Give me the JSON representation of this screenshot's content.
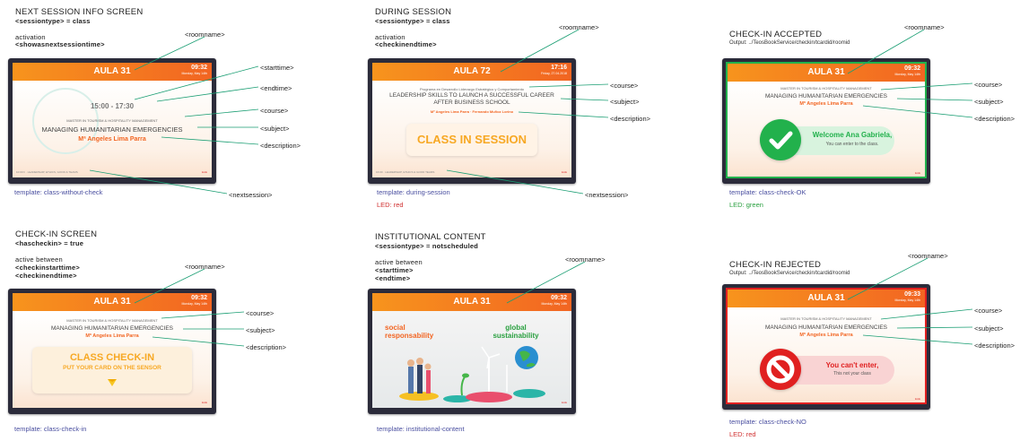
{
  "annotations": {
    "roomname": "<roomname>",
    "starttime": "<starttime>",
    "endtime": "<endtime>",
    "course": "<course>",
    "subject": "<subject>",
    "description": "<description>",
    "nextsession": "<nextsession>"
  },
  "screen_common": {
    "room_31": "AULA 31",
    "room_72": "AULA 72",
    "clock_0932": "09:32",
    "clock_0933": "09:33",
    "clock_1716": "17:16",
    "date_monday": "Monday, May 14th",
    "date_friday": "Friday, 27.04.2018",
    "course_mt": "MASTER IN TOURISM & HOSPITALITY MANAGEMENT",
    "subject_mhe": "MANAGING HUMANITARIAN EMERGENCIES",
    "desc_mlp": "Mª Angeles Lima Parra",
    "footer_next": "10:00 h · LEADERSHIP, ETHICS, GOOD & TEAMS",
    "footer_brand": "EAE"
  },
  "panels": {
    "next": {
      "title": "NEXT SESSION INFO SCREEN",
      "cond": "<sessiontype> = class",
      "activation_label": "activation",
      "activation_value": "<showasnextsessiontime>",
      "time": "15:00 - 17:30",
      "template": "template: class-without-check"
    },
    "during": {
      "title": "DURING SESSION",
      "cond": "<sessiontype> = class",
      "activation_label": "activation",
      "activation_value": "<checkinendtime>",
      "course": "Programa en Desarrollo Liderazgo Estratégico y Comportamiento",
      "subject": "LEADERSHIP SKILLS TO LAUNCH A SUCCESSFUL CAREER AFTER BUSINESS SCHOOL",
      "desc": "Mª Angeles Lima Parra · Fernando Muñoz Lorino",
      "banner": "CLASS IN SESSION",
      "footer": "16:00 · LEADERSHIP, ETHICS & GOOD TEAMS",
      "template": "template: during-session",
      "led": "LED: red"
    },
    "accepted": {
      "title": "CHECK-IN ACCEPTED",
      "output": "Output: ../TeosBookService/checkin/tcardid/roomid",
      "welcome": "Welcome Ana Gabriela,",
      "sub": "You can enter to the class.",
      "template": "template: class-check-OK",
      "led": "LED: green"
    },
    "checkin": {
      "title": "CHECK-IN SCREEN",
      "cond": "<hascheckin> = true",
      "active_label": "active between",
      "active_1": "<checkinstarttime>",
      "active_2": "<checkinendtime>",
      "banner1": "CLASS CHECK-IN",
      "banner2": "PUT YOUR CARD ON THE SENSOR",
      "template": "template: class-check-in"
    },
    "institutional": {
      "title": "INSTITUTIONAL CONTENT",
      "cond": "<sessiontype> = notscheduled",
      "active_label": "active between",
      "active_1": "<starttime>",
      "active_2": "<endtime>",
      "left_text": "social responsability",
      "right_text": "global sustainability",
      "template": "template: institutional-content"
    },
    "rejected": {
      "title": "CHECK-IN REJECTED",
      "output": "Output: ../TeosBookService/checkin/tcardid/roomid",
      "msg": "You can't enter,",
      "sub": "This not your class",
      "template": "template: class-check-NO",
      "led": "LED: red"
    }
  },
  "colors": {
    "orange": "#f26522",
    "green": "#22b14c",
    "red": "#e02020",
    "annotation_line": "#1a9e73",
    "template_text": "#4a4fa0"
  }
}
